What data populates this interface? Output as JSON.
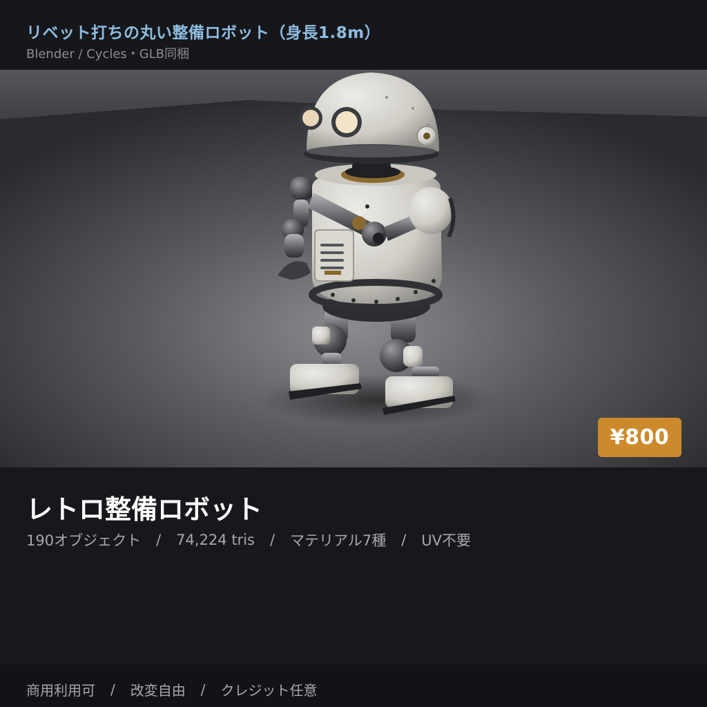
{
  "header": {
    "title": "リベット打ちの丸い整備ロボット（身長1.8m）",
    "subtitle": "Blender / Cycles・GLB同梱"
  },
  "preview": {
    "price": "¥800",
    "price_color": "#cc8a2c"
  },
  "product": {
    "title": "レトロ整備ロボット",
    "specs": [
      "190オブジェクト",
      "74,224 tris",
      "マテリアル7種",
      "UV不要"
    ],
    "separator": "/"
  },
  "license": {
    "items": [
      "商用利用可",
      "改変自由",
      "クレジット任意"
    ],
    "separator": "/"
  },
  "colors": {
    "title_accent": "#8fbde0",
    "background": "#17181c"
  }
}
